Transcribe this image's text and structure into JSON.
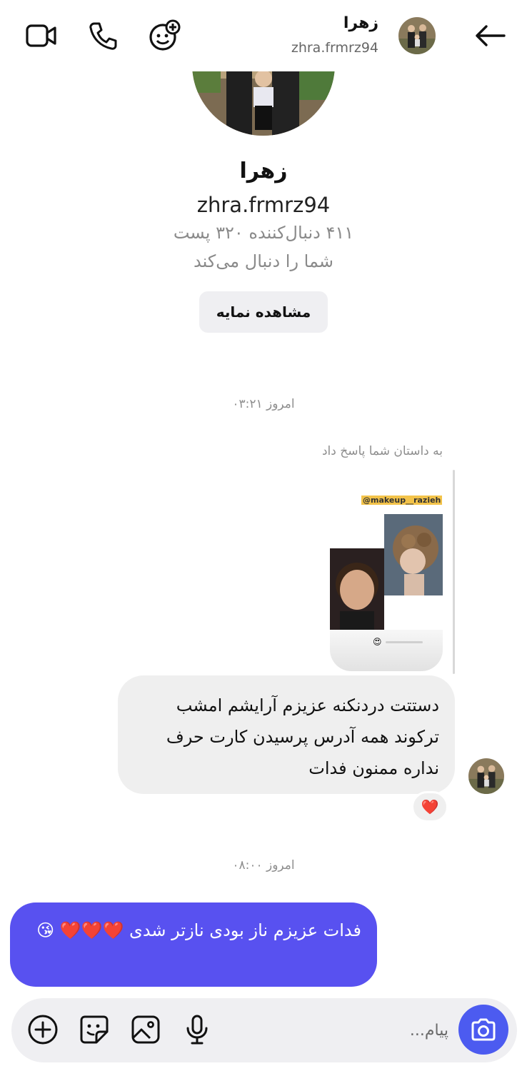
{
  "header": {
    "name": "زهرا",
    "username": "zhra.frmrz94",
    "icons": [
      "video-call-icon",
      "phone-icon",
      "add-people-icon",
      "back-arrow-icon"
    ]
  },
  "profile": {
    "name": "زهرا",
    "username": "zhra.frmrz94",
    "stats": "۴۱۱ دنبال‌کننده ۳۲۰ پست",
    "follows_you": "شما را دنبال می‌کند",
    "view_profile_label": "مشاهده نمایه"
  },
  "messages": {
    "timestamp_1": "امروز ۰۳:۲۱",
    "story_reply_label": "به داستان شما پاسخ داد",
    "story_tag": "@makeup__razieh",
    "incoming_text": "دستتت دردنکنه عزیزم آرایشم امشب ترکوند همه آدرس پرسیدن کارت حرف نداره ممنون فدات",
    "reaction": "❤️",
    "timestamp_2": "امروز ۰۸:۰۰",
    "outgoing_text": "فدات عزیزم ناز بودی نازتر شدی ❤️❤️❤️ 😘"
  },
  "composer": {
    "placeholder": "پیام...",
    "icons": [
      "camera-icon",
      "microphone-icon",
      "gallery-icon",
      "sticker-icon",
      "add-icon"
    ]
  },
  "colors": {
    "outgoing_bubble": "#5851f0",
    "incoming_bubble": "#efefef",
    "camera_button": "#4c5bf0"
  }
}
